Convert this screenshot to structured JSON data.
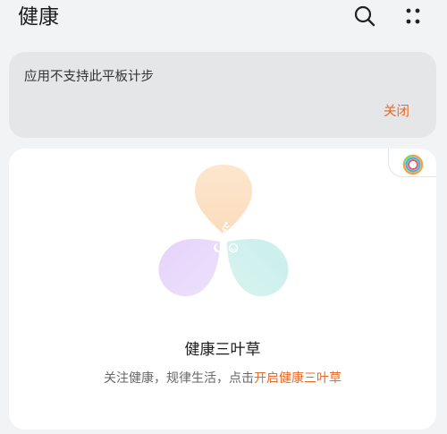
{
  "header": {
    "title": "健康",
    "search_icon": "search-icon",
    "more_icon": "more-grid-icon"
  },
  "notice": {
    "message": "应用不支持此平板计步",
    "close_label": "关闭"
  },
  "health_card": {
    "title": "健康三叶草",
    "description_prefix": "关注健康，规律生活，点击",
    "description_link": "开启健康三叶草",
    "badge_icon": "rainbow-ring-icon"
  },
  "colors": {
    "background": "#f1f3f5",
    "card": "#ffffff",
    "notice_card": "#e4e6e8",
    "accent": "#e86a2a",
    "leaf_activity": "#fde3c6",
    "leaf_sleep": "#e5d7fa",
    "leaf_mood": "#d1f1ee"
  }
}
